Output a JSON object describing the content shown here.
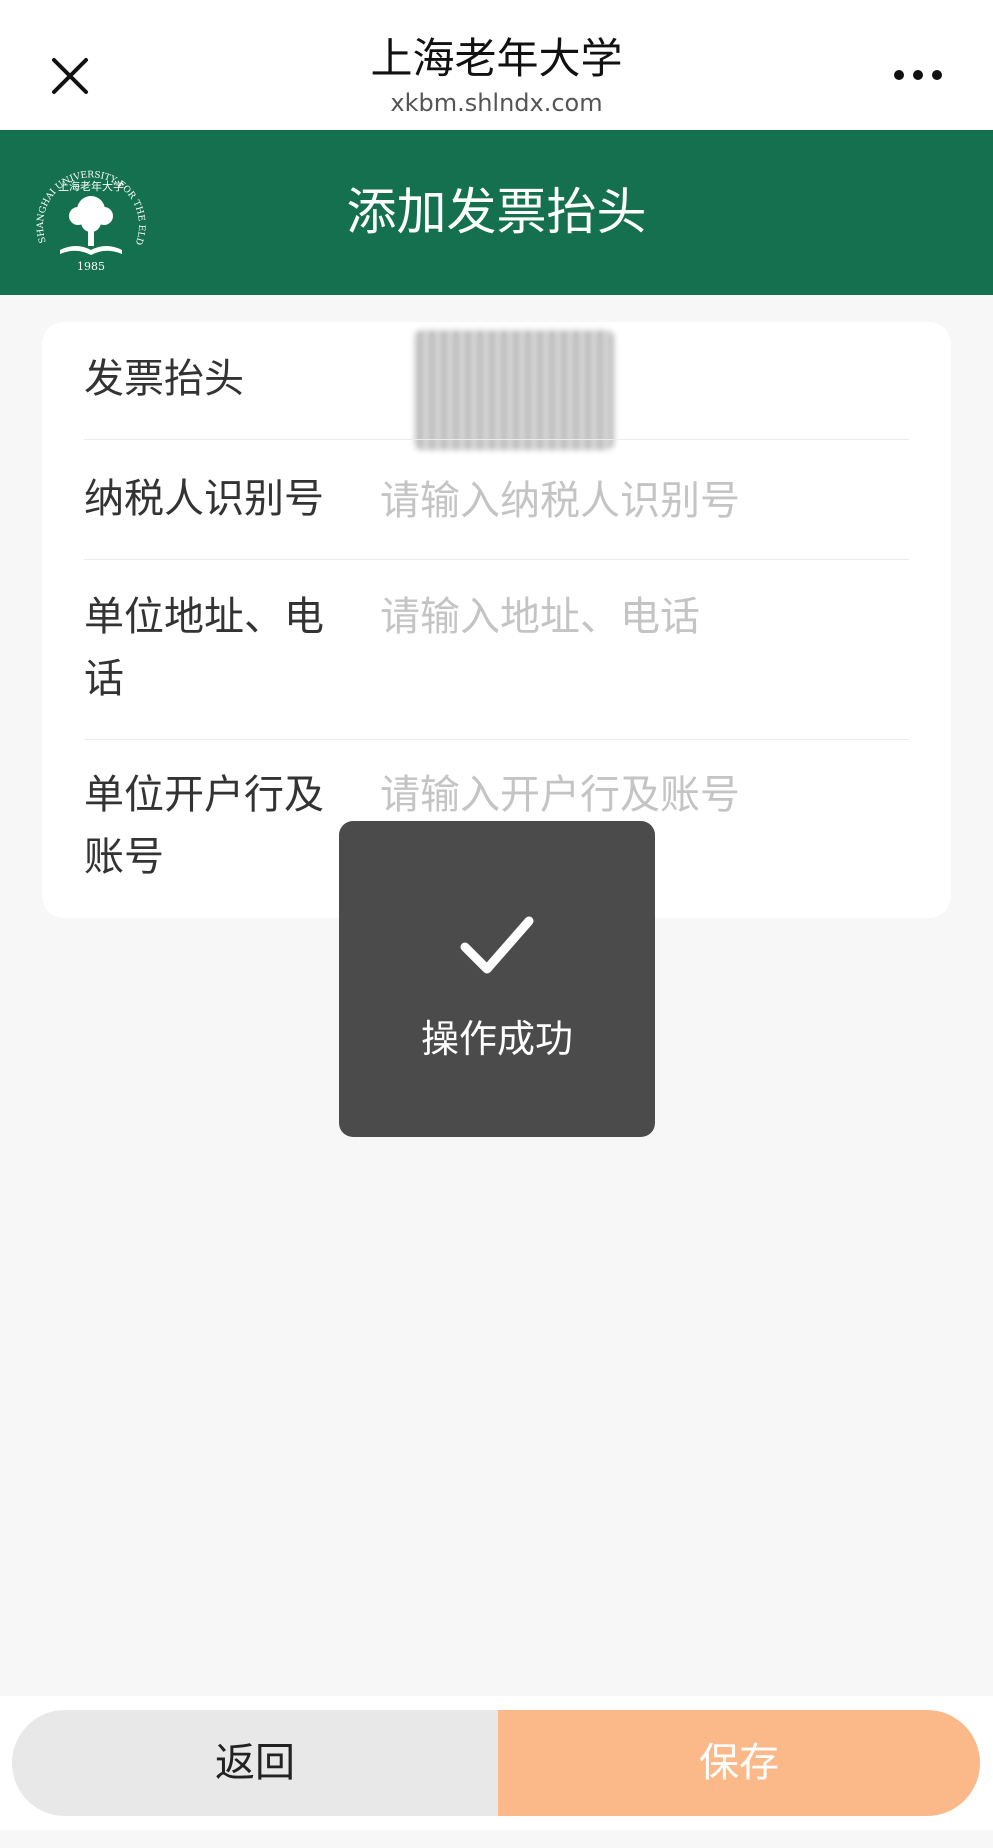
{
  "topbar": {
    "title": "上海老年大学",
    "url": "xkbm.shlndx.com"
  },
  "header": {
    "title": "添加发票抬头",
    "logo_text": {
      "arc": "SHANGHAI UNIVERSITY FOR THE ELDERLY",
      "chinese": "上海老年大学",
      "year": "1985"
    }
  },
  "form": {
    "rows": [
      {
        "label": "发票抬头",
        "value": "",
        "placeholder": ""
      },
      {
        "label": "纳税人识别号",
        "value": "",
        "placeholder": "请输入纳税人识别号"
      },
      {
        "label": "单位地址、电话",
        "value": "",
        "placeholder": "请输入地址、电话"
      },
      {
        "label": "单位开户行及账号",
        "value": "",
        "placeholder": "请输入开户行及账号"
      }
    ]
  },
  "toast": {
    "icon": "checkmark-icon",
    "text": "操作成功"
  },
  "buttons": {
    "back": "返回",
    "save": "保存"
  },
  "colors": {
    "header_green": "#15704f",
    "save_orange": "#fbb98a",
    "back_gray": "#e8e8e8",
    "toast_bg": "#4b4b4b",
    "placeholder": "#c4c4c4"
  }
}
